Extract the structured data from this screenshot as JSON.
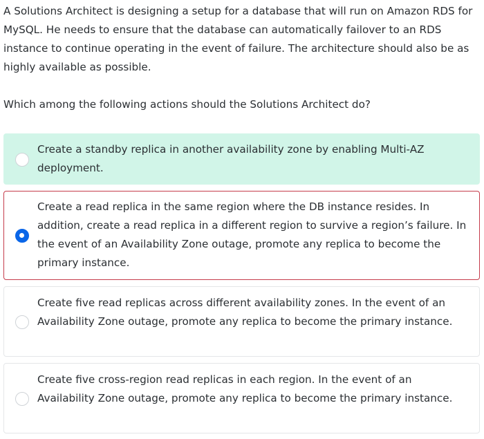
{
  "question": {
    "text": "A Solutions Architect is designing a setup for a database that will run on Amazon RDS for MySQL. He needs to ensure that the database can automatically failover to an RDS instance to continue operating in the event of failure. The architecture should also be as highly available as possible.",
    "prompt": "Which among the following actions should the Solutions Architect do?"
  },
  "options": [
    {
      "text": "Create a standby replica in another availability zone by enabling Multi-AZ deployment.",
      "state": "correct",
      "checked": false
    },
    {
      "text": "Create a read replica in the same region where the DB instance resides. In addition, create a read replica in a different region to survive a region’s failure. In the event of an Availability Zone outage, promote any replica to become the primary instance.",
      "state": "selected-incorrect",
      "checked": true
    },
    {
      "text": "Create five read replicas across different availability zones. In the event of an Availability Zone outage, promote any replica to become the primary instance.",
      "state": "default",
      "checked": false
    },
    {
      "text": "Create five cross-region read replicas in each region. In the event of an Availability Zone outage, promote any replica to become the primary instance.",
      "state": "default",
      "checked": false
    }
  ],
  "colors": {
    "correct_bg": "#d1f5e8",
    "incorrect_border": "#c53b4a",
    "radio_checked": "#0a66e8",
    "text": "#2b2f33"
  }
}
